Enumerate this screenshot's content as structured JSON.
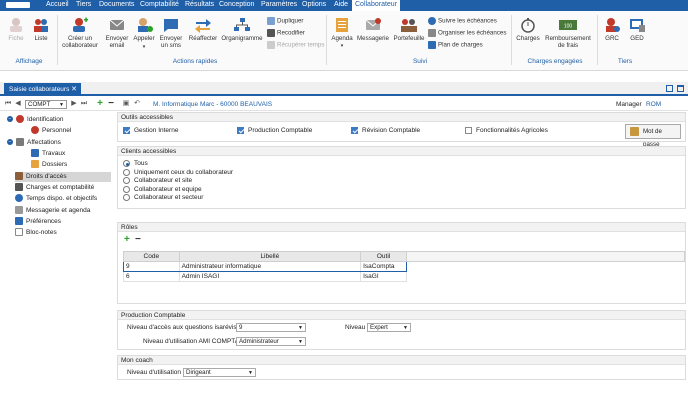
{
  "menu": {
    "items": [
      "Accueil",
      "Tiers",
      "Documents",
      "Comptabilité",
      "Résultats",
      "Conception",
      "Paramètres",
      "Options",
      "Aide",
      "Collaborateur"
    ],
    "active": "Collaborateur"
  },
  "ribbon": {
    "affichage": {
      "label": "Affichage",
      "fiche": "Fiche",
      "liste": "Liste"
    },
    "actions": {
      "label": "Actions rapides",
      "creer": "Créer un collaborateur",
      "envoyer_email": "Envoyer email",
      "appeler": "Appeler",
      "envoyer_sms": "Envoyer un sms",
      "reaffecter": "Réaffecter",
      "organigramme": "Organigramme",
      "dupliquer": "Dupliquer",
      "recodifier": "Recodifier",
      "recuperer": "Récupérer temps"
    },
    "suivi": {
      "label": "Suivi",
      "agenda": "Agenda",
      "messagerie": "Messagerie",
      "portefeuille": "Portefeuille",
      "suivre": "Suivre les échéances",
      "organiser": "Organiser les échéances",
      "plan": "Plan de charges"
    },
    "charges": {
      "label": "Charges engagées",
      "charges": "Charges",
      "remboursement": "Remboursement de frais",
      "amount": "100"
    },
    "tiers": {
      "label": "Tiers",
      "grc": "GRC",
      "ged": "GED"
    }
  },
  "tab": {
    "title": "Saisie collaborateurs"
  },
  "toolbar": {
    "compte": "COMPT",
    "company": "M. Informatique Marc - 60000 BEAUVAIS",
    "manager_label": "Manager",
    "manager_value": "ROM"
  },
  "tree": {
    "identification": "Identification",
    "personnel": "Personnel",
    "affectations": "Affectations",
    "travaux": "Travaux",
    "dossiers": "Dossiers",
    "droits": "Droits d'accès",
    "charges": "Charges et comptabilité",
    "temps": "Temps dispo. et objectifs",
    "messagerie": "Messagerie et agenda",
    "preferences": "Préférences",
    "blocnotes": "Bloc-notes"
  },
  "outils": {
    "title": "Outils accessibles",
    "gestion": "Gestion Interne",
    "production": "Production Comptable",
    "revision": "Révision Comptable",
    "agricoles": "Fonctionnalités Agricoles",
    "motdepasse": "Mot de passe"
  },
  "clients": {
    "title": "Clients accessibles",
    "options": [
      "Tous",
      "Uniquement ceux du collaborateur",
      "Collaborateur et site",
      "Collaborateur et equipe",
      "Collaborateur et secteur"
    ],
    "selected": "Tous"
  },
  "roles": {
    "title": "Rôles",
    "columns": [
      "Code",
      "Libellé",
      "Outil"
    ],
    "rows": [
      {
        "code": "9",
        "libelle": "Administrateur informatique",
        "outil": "IsaCompta"
      },
      {
        "code": "6",
        "libelle": "Admin ISAGI",
        "outil": "IsaGI"
      }
    ]
  },
  "production": {
    "title": "Production Comptable",
    "niveau_questions_label": "Niveau d'accès aux questions isarévise",
    "niveau_questions_value": "9",
    "niveau_label": "Niveau",
    "niveau_value": "Expert",
    "ami_label": "Niveau d'utilisation AMI COMPTA",
    "ami_value": "Administrateur"
  },
  "coach": {
    "title": "Mon coach",
    "niveau_label": "Niveau d'utilisation",
    "niveau_value": "Dirigeant"
  }
}
